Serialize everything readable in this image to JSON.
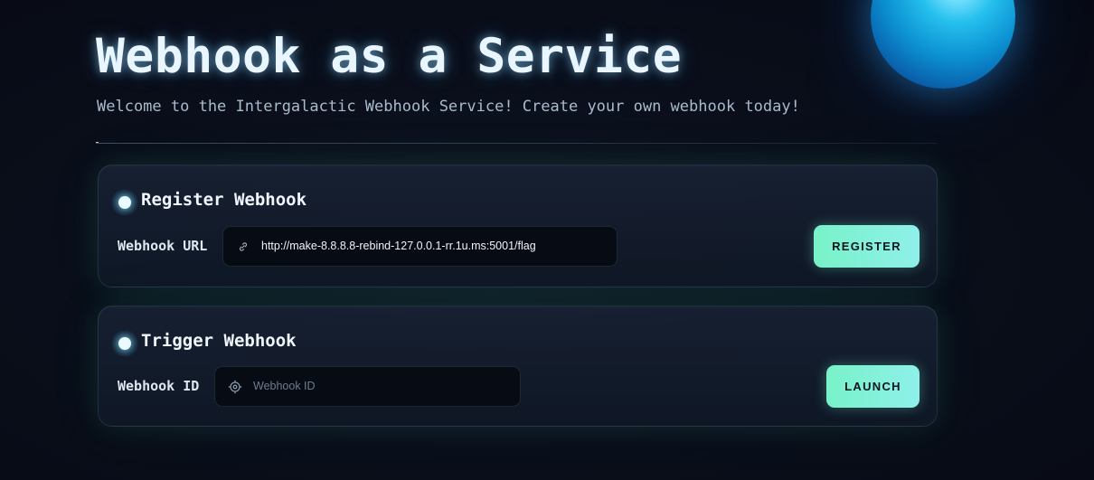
{
  "header": {
    "title": "Webhook as a Service",
    "subtitle": "Welcome to the Intergalactic Webhook Service! Create your own webhook today!"
  },
  "register": {
    "title": "Register Webhook",
    "field_label": "Webhook URL",
    "input_value": "http://make-8.8.8.8-rebind-127.0.0.1-rr.1u.ms:5001/flag",
    "input_icon": "link-icon",
    "button_label": "REGISTER"
  },
  "trigger": {
    "title": "Trigger Webhook",
    "field_label": "Webhook ID",
    "input_value": "",
    "input_placeholder": "Webhook ID",
    "input_icon": "crosshair-icon",
    "button_label": "LAUNCH"
  },
  "colors": {
    "accent": "#78f2c8",
    "accent_end": "#8ff0ea",
    "background": "#0a0f1b",
    "orb": "#25c0ee"
  }
}
